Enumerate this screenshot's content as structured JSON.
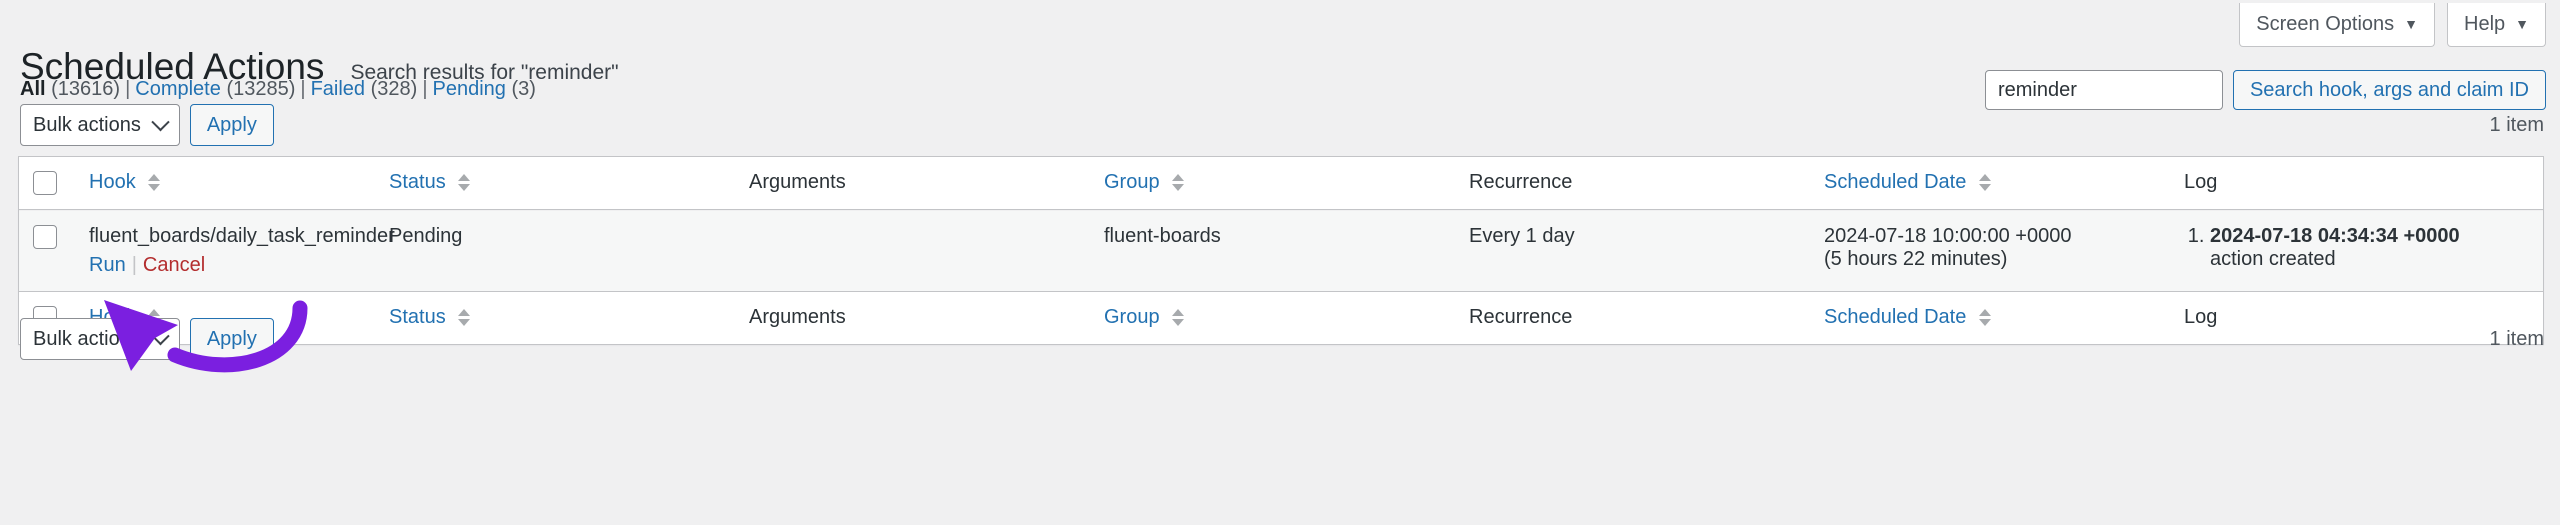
{
  "meta_bar": {
    "screen_options_label": "Screen Options",
    "help_label": "Help",
    "caret": "▼"
  },
  "header": {
    "page_title": "Scheduled Actions",
    "search_subtitle": "Search results for \"reminder\""
  },
  "filters": [
    {
      "label": "All",
      "count": "(13616)",
      "current": true
    },
    {
      "label": "Complete",
      "count": "(13285)",
      "current": false
    },
    {
      "label": "Failed",
      "count": "(328)",
      "current": false
    },
    {
      "label": "Pending",
      "count": "(3)",
      "current": false
    }
  ],
  "search": {
    "value": "reminder",
    "placeholder": "",
    "submit_label": "Search hook, args and claim ID"
  },
  "tablenav": {
    "bulk_actions_label": "Bulk actions",
    "apply_label": "Apply",
    "item_count": "1 item"
  },
  "table": {
    "columns": [
      {
        "label": "Hook",
        "sortable": true
      },
      {
        "label": "Status",
        "sortable": true
      },
      {
        "label": "Arguments",
        "sortable": false
      },
      {
        "label": "Group",
        "sortable": true
      },
      {
        "label": "Recurrence",
        "sortable": false
      },
      {
        "label": "Scheduled Date",
        "sortable": true
      },
      {
        "label": "Log",
        "sortable": false
      }
    ],
    "rows": [
      {
        "hook": "fluent_boards/daily_task_reminder",
        "actions": {
          "run": "Run",
          "separator": "|",
          "cancel": "Cancel"
        },
        "status": "Pending",
        "arguments": "",
        "group": "fluent-boards",
        "recurrence": "Every 1 day",
        "scheduled_date": "2024-07-18 10:00:00 +0000",
        "scheduled_relative": "(5 hours 22 minutes)",
        "log": [
          {
            "timestamp": "2024-07-18 04:34:34 +0000",
            "message": "action created"
          }
        ]
      }
    ]
  },
  "annotation": {
    "arrow_color": "#7B1FE0",
    "points_at": "Run"
  }
}
